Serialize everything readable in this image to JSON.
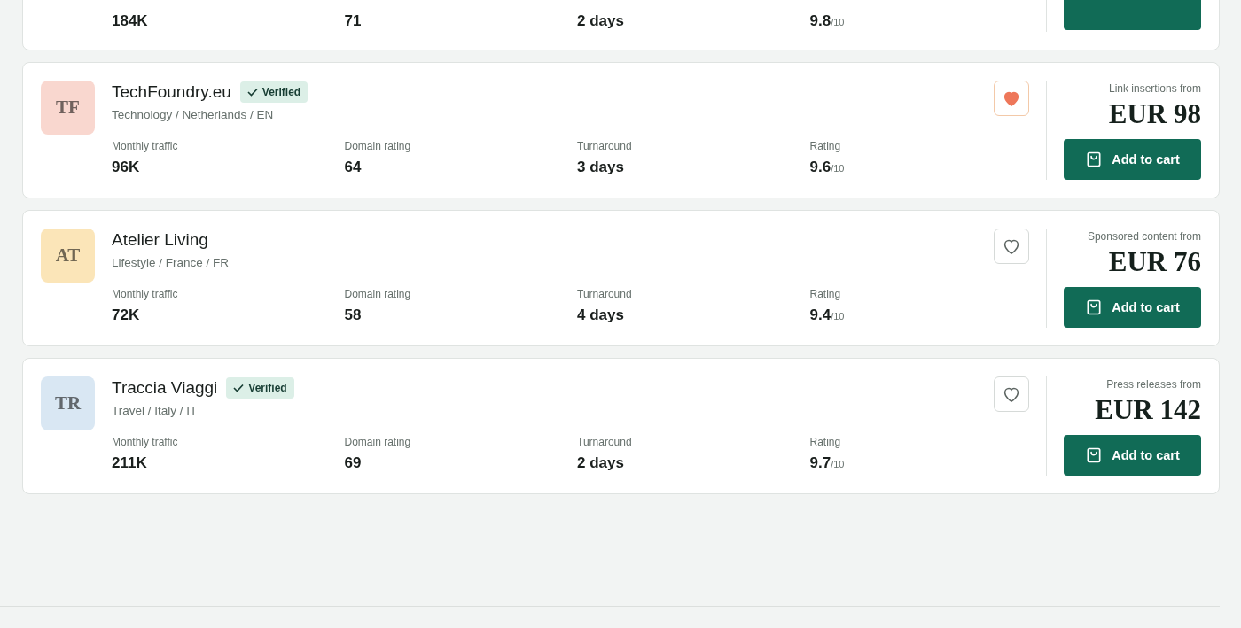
{
  "listings": [
    {
      "kind": "partial",
      "stats": [
        {
          "value": "184K"
        },
        {
          "value": "71"
        },
        {
          "value": "2 days"
        },
        {
          "value": "9.8",
          "suffix": "/10"
        }
      ]
    },
    {
      "kind": "full",
      "initials": "TF",
      "color": "#f9d7cf",
      "name": "TechFoundry.eu",
      "verified": true,
      "badge": "Verified",
      "meta": "Technology / Netherlands / EN",
      "favorite": true,
      "stats": [
        {
          "label": "Monthly traffic",
          "value": "96K"
        },
        {
          "label": "Domain rating",
          "value": "64"
        },
        {
          "label": "Turnaround",
          "value": "3 days"
        },
        {
          "label": "Rating",
          "value": "9.6",
          "suffix": "/10"
        }
      ],
      "price_label": "Link insertions from",
      "price": "EUR 98",
      "cta": "Add to cart"
    },
    {
      "kind": "full",
      "initials": "AT",
      "color": "#fbe5b8",
      "name": "Atelier Living",
      "verified": false,
      "meta": "Lifestyle / France / FR",
      "favorite": false,
      "stats": [
        {
          "label": "Monthly traffic",
          "value": "72K"
        },
        {
          "label": "Domain rating",
          "value": "58"
        },
        {
          "label": "Turnaround",
          "value": "4 days"
        },
        {
          "label": "Rating",
          "value": "9.4",
          "suffix": "/10"
        }
      ],
      "price_label": "Sponsored content from",
      "price": "EUR 76",
      "cta": "Add to cart"
    },
    {
      "kind": "full",
      "initials": "TR",
      "color": "#d9e7f3",
      "name": "Traccia Viaggi",
      "verified": true,
      "badge": "Verified",
      "meta": "Travel / Italy / IT",
      "favorite": false,
      "stats": [
        {
          "label": "Monthly traffic",
          "value": "211K"
        },
        {
          "label": "Domain rating",
          "value": "69"
        },
        {
          "label": "Turnaround",
          "value": "2 days"
        },
        {
          "label": "Rating",
          "value": "9.7",
          "suffix": "/10"
        }
      ],
      "price_label": "Press releases from",
      "price": "EUR 142",
      "cta": "Add to cart"
    }
  ]
}
